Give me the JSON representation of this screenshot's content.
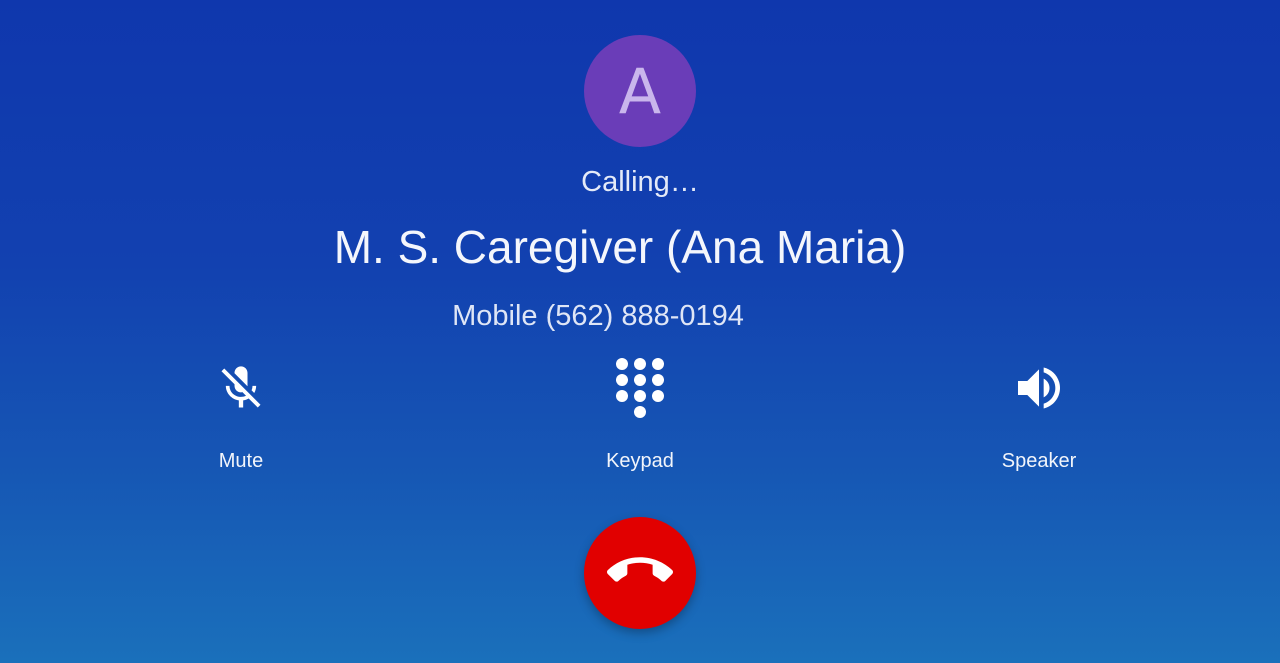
{
  "caller": {
    "avatar_letter": "A",
    "status": "Calling…",
    "name": "M. S. Caregiver (Ana Maria)",
    "number_line": "Mobile (562) 888-0194"
  },
  "controls": [
    {
      "label": "Mute",
      "icon": "mic-off-icon"
    },
    {
      "label": "Keypad",
      "icon": "dialpad-icon"
    },
    {
      "label": "Speaker",
      "icon": "volume-up-icon"
    }
  ],
  "end_call": {
    "icon": "call-end-icon"
  },
  "colors": {
    "background_top": "#0f37ad",
    "background_bottom": "#1a70bb",
    "avatar": "#6a3db8",
    "end_call": "#e10000"
  }
}
